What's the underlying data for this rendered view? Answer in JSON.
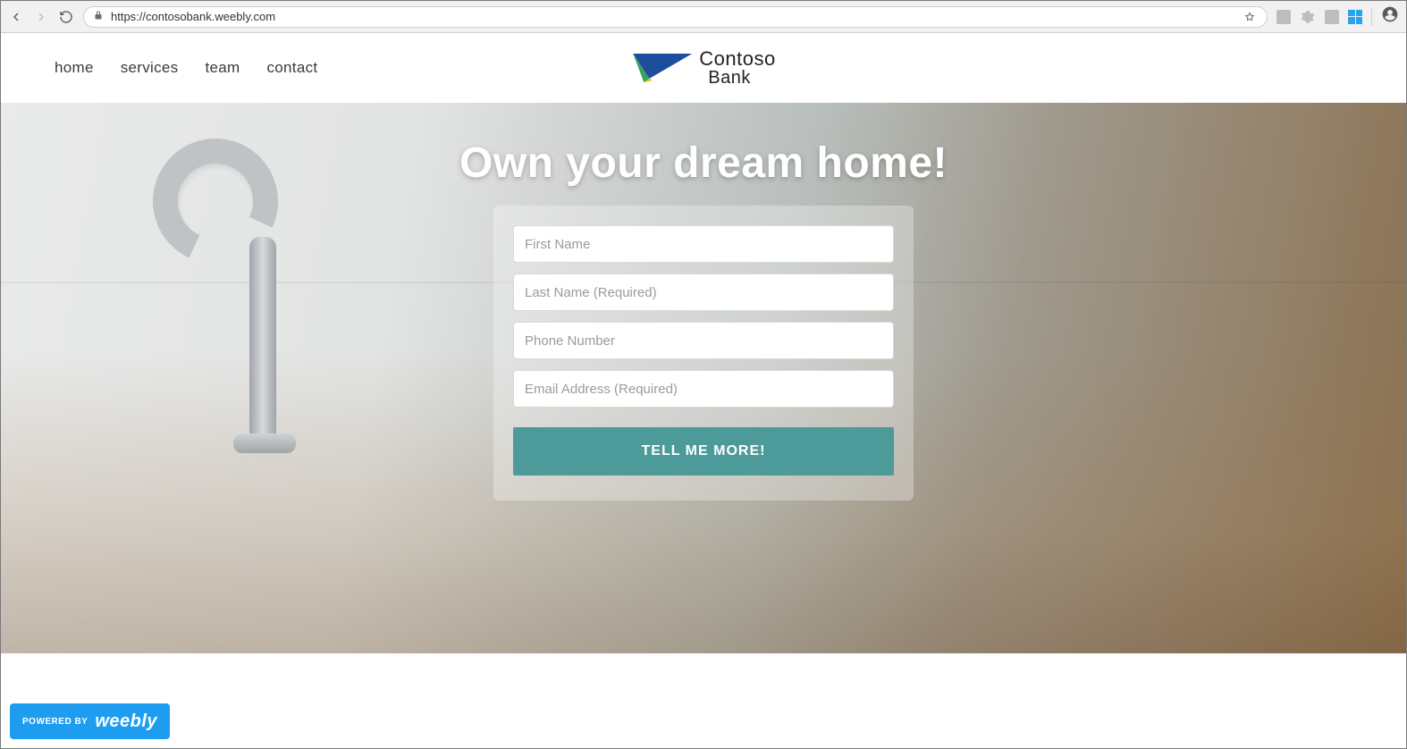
{
  "browser": {
    "url": "https://contosobank.weebly.com"
  },
  "nav": {
    "items": [
      {
        "label": "home"
      },
      {
        "label": "services"
      },
      {
        "label": "team"
      },
      {
        "label": "contact"
      }
    ]
  },
  "logo": {
    "line1": "Contoso",
    "line2": "Bank"
  },
  "hero": {
    "title": "Own your dream home!"
  },
  "form": {
    "first_name_placeholder": "First Name",
    "last_name_placeholder": "Last Name (Required)",
    "phone_placeholder": "Phone Number",
    "email_placeholder": "Email Address (Required)",
    "submit_label": "TELL ME MORE!"
  },
  "badge": {
    "powered_by": "POWERED BY",
    "brand": "weebly"
  },
  "colors": {
    "accent": "#4c9a99",
    "badge": "#1e9df0"
  }
}
